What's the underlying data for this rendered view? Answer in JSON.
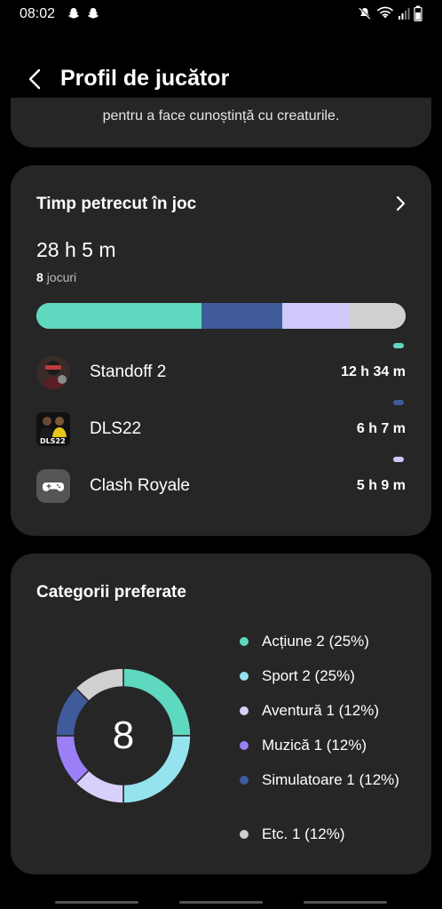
{
  "status_bar": {
    "time": "08:02",
    "left_icons": [
      "snapchat-icon",
      "snapchat-icon"
    ],
    "right_icons": [
      "mute-icon",
      "wifi-icon",
      "signal-icon",
      "battery-icon"
    ]
  },
  "header": {
    "title": "Profil de jucător",
    "back_icon": "back-arrow-icon"
  },
  "intro_card": {
    "text": "pentru a face cunoștință cu creaturile."
  },
  "time_card": {
    "title": "Timp petrecut în joc",
    "total": "28 h 5 m",
    "games_count": "8",
    "games_label": "jocuri",
    "bar_segments": [
      {
        "color": "#5fd8c0",
        "fraction": 0.448
      },
      {
        "color": "#3f5b9c",
        "fraction": 0.218
      },
      {
        "color": "#cfc8fa",
        "fraction": 0.183
      },
      {
        "color": "#d0d0d0",
        "fraction": 0.151
      }
    ],
    "games": [
      {
        "name": "Standoff 2",
        "time": "12 h 34 m",
        "color": "#5fd8c0"
      },
      {
        "name": "DLS22",
        "time": "6 h 7 m",
        "color": "#3f5b9c"
      },
      {
        "name": "Clash Royale",
        "time": "5 h 9 m",
        "color": "#cfc8fa"
      }
    ]
  },
  "category_card": {
    "title": "Categorii preferate",
    "center_value": "8",
    "legend": [
      {
        "label": "Acțiune 2 (25%)",
        "color": "#5fd8c0",
        "share": 25
      },
      {
        "label": "Sport 2 (25%)",
        "color": "#94e3ee",
        "share": 25
      },
      {
        "label": "Aventură 1 (12%)",
        "color": "#d7d0fb",
        "share": 12.5
      },
      {
        "label": "Muzică 1 (12%)",
        "color": "#9a7ff6",
        "share": 12.5
      },
      {
        "label": "Simulatoare 1 (12%)",
        "color": "#3f5b9c",
        "share": 12.5
      },
      {
        "label": "Etc. 1 (12%)",
        "color": "#d0d0d0",
        "share": 12.5
      }
    ]
  }
}
